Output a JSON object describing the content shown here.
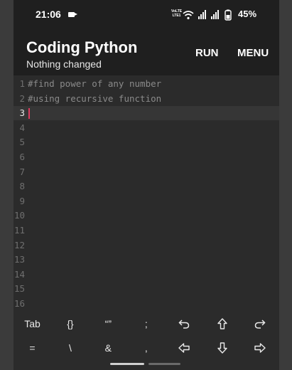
{
  "status_bar": {
    "time": "21:06",
    "volte_top": "VoLTE",
    "volte_bottom": "LTE1",
    "battery": "45%"
  },
  "app_bar": {
    "title": "Coding Python",
    "subtitle": "Nothing changed",
    "run_label": "RUN",
    "menu_label": "MENU"
  },
  "editor": {
    "lines": [
      {
        "num": "1",
        "text": "#find power of any number"
      },
      {
        "num": "2",
        "text": "#using recursive function"
      },
      {
        "num": "3",
        "text": ""
      },
      {
        "num": "4",
        "text": ""
      },
      {
        "num": "5",
        "text": ""
      },
      {
        "num": "6",
        "text": ""
      },
      {
        "num": "7",
        "text": ""
      },
      {
        "num": "8",
        "text": ""
      },
      {
        "num": "9",
        "text": ""
      },
      {
        "num": "10",
        "text": ""
      },
      {
        "num": "11",
        "text": ""
      },
      {
        "num": "12",
        "text": ""
      },
      {
        "num": "13",
        "text": ""
      },
      {
        "num": "14",
        "text": ""
      },
      {
        "num": "15",
        "text": ""
      },
      {
        "num": "16",
        "text": ""
      }
    ],
    "active_line": 3
  },
  "keys": {
    "row1": [
      {
        "label": "Tab",
        "icon": null
      },
      {
        "label": "{}",
        "icon": null
      },
      {
        "label": "“”",
        "icon": null
      },
      {
        "label": ";",
        "icon": null
      },
      {
        "label": "",
        "icon": "undo-icon"
      },
      {
        "label": "",
        "icon": "arrow-up-icon"
      },
      {
        "label": "",
        "icon": "redo-icon"
      }
    ],
    "row2": [
      {
        "label": "=",
        "icon": null
      },
      {
        "label": "\\",
        "icon": null
      },
      {
        "label": "&",
        "icon": null
      },
      {
        "label": ",",
        "icon": null
      },
      {
        "label": "",
        "icon": "arrow-left-icon"
      },
      {
        "label": "",
        "icon": "arrow-down-icon"
      },
      {
        "label": "",
        "icon": "arrow-right-icon"
      }
    ]
  },
  "colors": {
    "background": "#2b2b2b",
    "bar": "#1f1f1f",
    "caret": "#e03a5e",
    "comment": "#8a8a8a"
  }
}
